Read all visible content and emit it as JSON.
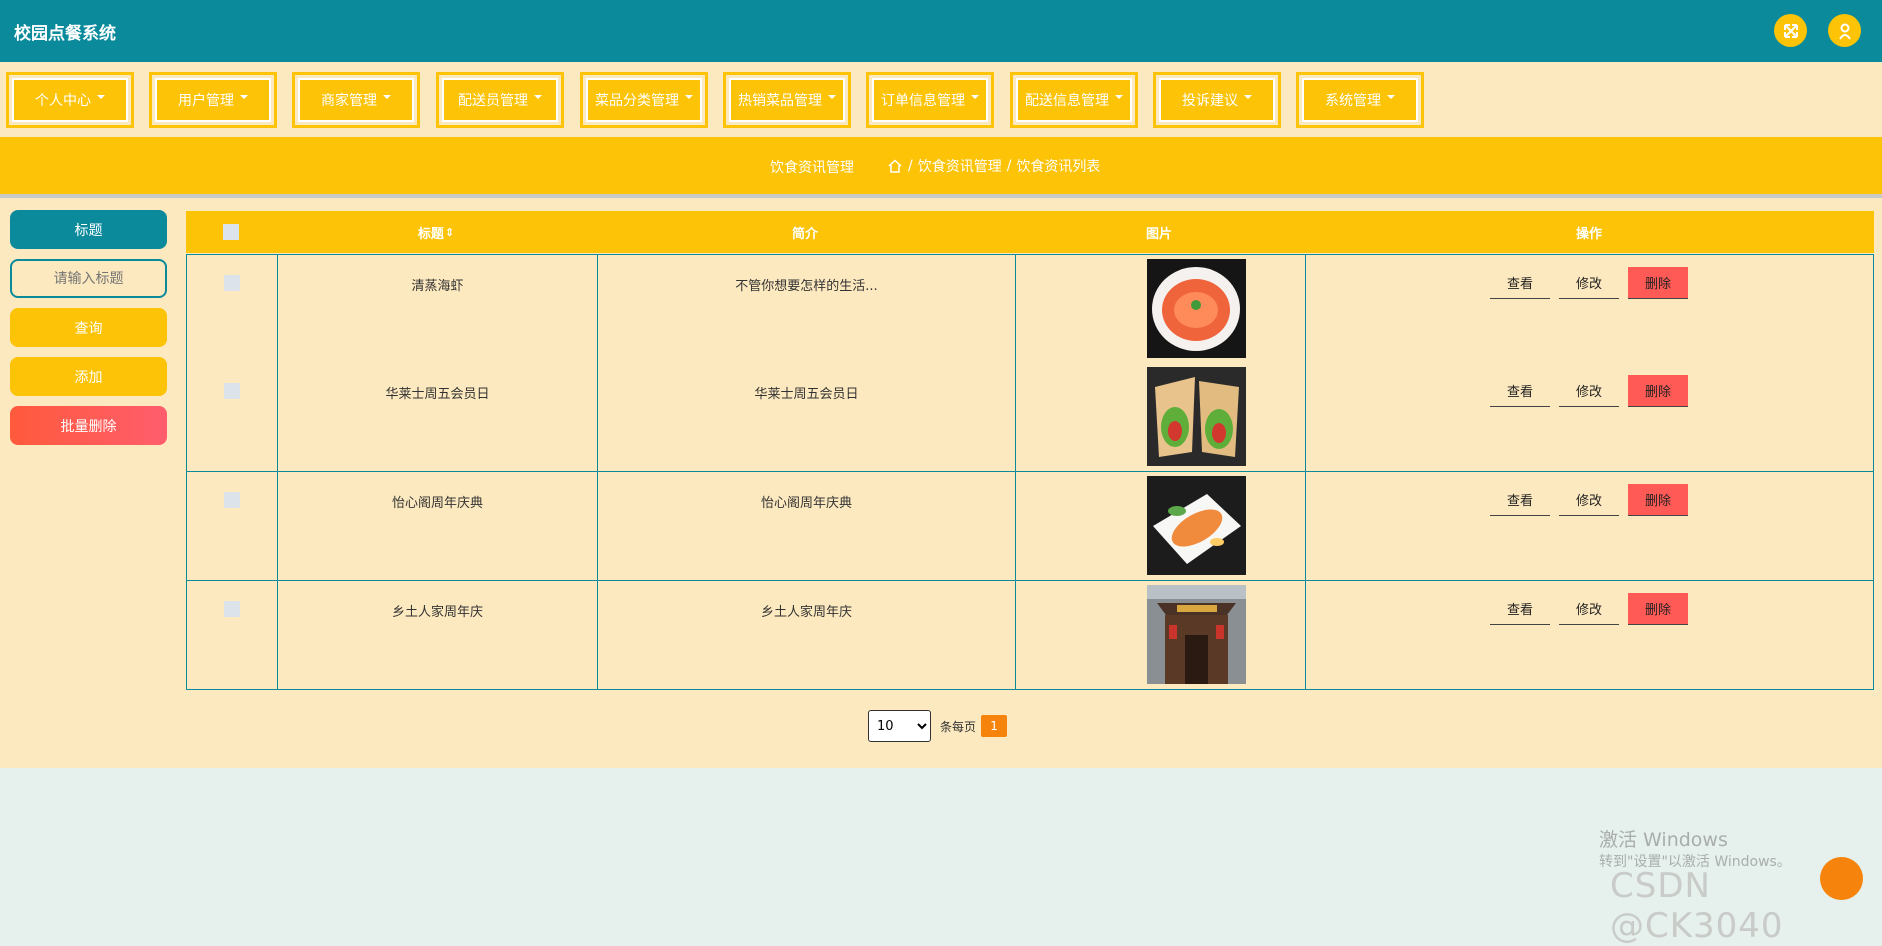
{
  "app": {
    "title": "校园点餐系统"
  },
  "header": {
    "icons": [
      "expand-icon",
      "user-icon"
    ]
  },
  "nav": {
    "items": [
      {
        "label": "个人中心"
      },
      {
        "label": "用户管理"
      },
      {
        "label": "商家管理"
      },
      {
        "label": "配送员管理"
      },
      {
        "label": "菜品分类管理"
      },
      {
        "label": "热销菜品管理"
      },
      {
        "label": "订单信息管理"
      },
      {
        "label": "配送信息管理"
      },
      {
        "label": "投诉建议"
      },
      {
        "label": "系统管理"
      }
    ]
  },
  "breadcrumb": {
    "title": "饮食资讯管理",
    "separator": "/",
    "path": [
      "饮食资讯管理",
      "饮食资讯列表"
    ]
  },
  "sidebar": {
    "field_label": "标题",
    "search_placeholder": "请输入标题",
    "query_label": "查询",
    "add_label": "添加",
    "batch_delete_label": "批量删除"
  },
  "table": {
    "columns": [
      "",
      "标题",
      "简介",
      "图片",
      "操作"
    ],
    "sort_mark": "⇕",
    "rows": [
      {
        "title": "清蒸海虾",
        "intro": "不管你想要怎样的生活...",
        "image": "shrimp-dish-image"
      },
      {
        "title": "华莱士周五会员日",
        "intro": "华莱士周五会员日",
        "image": "wrap-dish-image"
      },
      {
        "title": "怡心阁周年庆典",
        "intro": "怡心阁周年庆典",
        "image": "platter-dish-image"
      },
      {
        "title": "乡土人家周年庆",
        "intro": "乡土人家周年庆",
        "image": "restaurant-front-image"
      }
    ],
    "actions": {
      "view": "查看",
      "edit": "修改",
      "delete": "删除"
    }
  },
  "pagination": {
    "page_size": "10",
    "page_size_options": [
      "10"
    ],
    "per_page_label": "条每页",
    "current_page": "1"
  },
  "overlay": {
    "activate_title": "激活 Windows",
    "activate_sub": "转到\"设置\"以激活 Windows。",
    "csdn_mark": "CSDN @CK3040"
  },
  "colors": {
    "teal": "#0a8a9b",
    "yellow": "#fcc307",
    "cream": "#fde9bf",
    "delete_red": "#ff5a55",
    "orange": "#f6830c"
  }
}
